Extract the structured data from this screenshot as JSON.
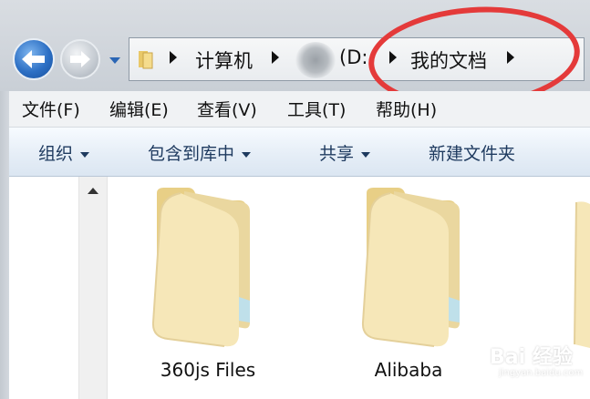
{
  "address_bar": {
    "segments": [
      "计算机",
      "(D:",
      "我的文档"
    ]
  },
  "menu": {
    "items": [
      "文件(F)",
      "编辑(E)",
      "查看(V)",
      "工具(T)",
      "帮助(H)"
    ]
  },
  "toolbar": {
    "organize": "组织",
    "include_library": "包含到库中",
    "share": "共享",
    "new_folder": "新建文件夹"
  },
  "files": [
    {
      "name": "360js Files",
      "type": "folder"
    },
    {
      "name": "Alibaba",
      "type": "folder"
    }
  ],
  "watermark": {
    "text": "Bai 经验",
    "sub": "jingyan.baidu.com"
  },
  "colors": {
    "annotation": "#e43a3a",
    "toolbar_text": "#1e3a5f",
    "folder": "#f3dfa2"
  }
}
